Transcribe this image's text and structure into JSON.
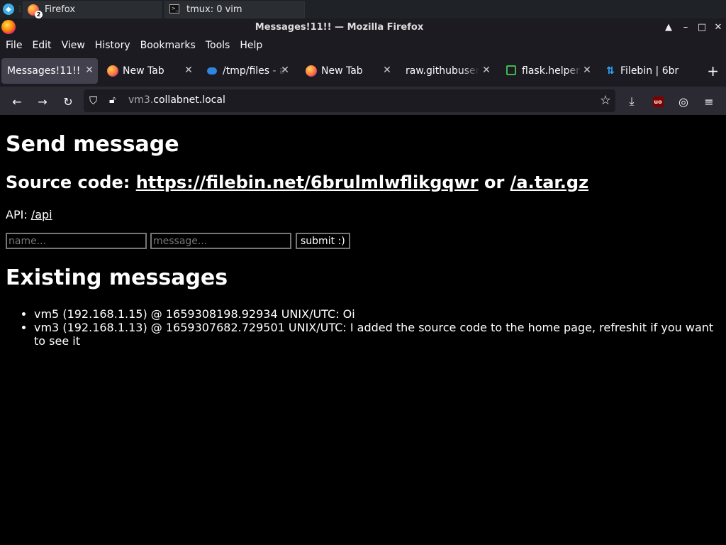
{
  "taskbar": {
    "tasks": [
      {
        "label": "Firefox",
        "badge": "2",
        "icon": "firefox-icon"
      },
      {
        "label": "tmux: 0 vim",
        "icon": "terminal-icon"
      }
    ]
  },
  "window": {
    "title": "Messages!11!! — Mozilla Firefox",
    "controls": [
      "▲",
      "–",
      "□",
      "✕"
    ]
  },
  "menu": [
    "File",
    "Edit",
    "View",
    "History",
    "Bookmarks",
    "Tools",
    "Help"
  ],
  "tabs": [
    {
      "label": "Messages!11!!",
      "active": true
    },
    {
      "label": "New Tab"
    },
    {
      "label": "/tmp/files - a"
    },
    {
      "label": "New Tab"
    },
    {
      "label": "raw.githubuserc"
    },
    {
      "label": "flask.helpers"
    },
    {
      "label": "Filebin | 6br"
    }
  ],
  "nav": {
    "url_prefix": "vm3.",
    "url_domain": "collabnet.local"
  },
  "page": {
    "heading": "Send message",
    "source_label": "Source code: ",
    "source_link": "https://filebin.net/6brulmlwflikgqwr",
    "source_or": " or ",
    "source_tar": "/a.tar.gz",
    "api_label": "API: ",
    "api_link": "/api",
    "name_placeholder": "name...",
    "message_placeholder": "message...",
    "submit_label": "submit :)",
    "existing_heading": "Existing messages",
    "messages": [
      "vm5 (192.168.1.15) @ 1659308198.92934 UNIX/UTC: Oi",
      "vm3 (192.168.1.13) @ 1659307682.729501 UNIX/UTC: I added the source code to the home page, refreshit if you want to see it"
    ]
  }
}
